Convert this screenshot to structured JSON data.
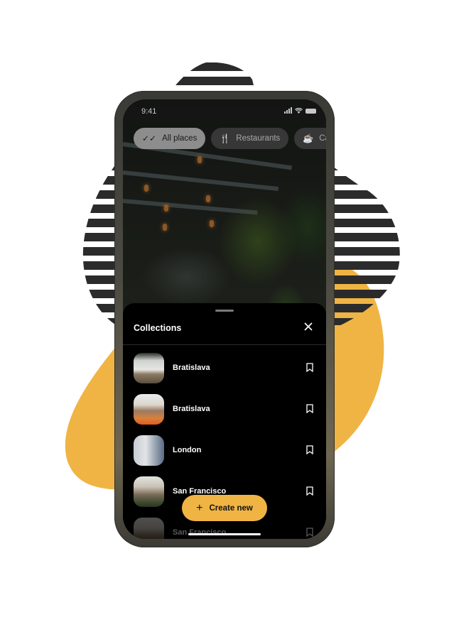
{
  "colors": {
    "accent": "#f0b444",
    "stripe": "#2b2b2b",
    "sheet_bg": "#000000",
    "chip_active_bg": "#8d8d8d"
  },
  "status_bar": {
    "time": "9:41",
    "icons": [
      "signal-icon",
      "wifi-icon",
      "battery-icon"
    ]
  },
  "filters": [
    {
      "label": "All places",
      "icon": "double-check-icon",
      "active": true
    },
    {
      "label": "Restaurants",
      "icon": "fork-knife-icon",
      "active": false
    },
    {
      "label": "Café",
      "icon": "coffee-cup-icon",
      "active": false
    }
  ],
  "sheet": {
    "title": "Collections",
    "close_icon": "close-icon",
    "items": [
      {
        "name": "Bratislava",
        "icon": "bookmark-icon"
      },
      {
        "name": "Bratislava",
        "icon": "bookmark-icon"
      },
      {
        "name": "London",
        "icon": "bookmark-icon"
      },
      {
        "name": "San Francisco",
        "icon": "bookmark-icon"
      },
      {
        "name": "San Francisco",
        "icon": "bookmark-icon"
      }
    ],
    "create_button": {
      "label": "Create new",
      "icon": "plus-icon"
    }
  }
}
